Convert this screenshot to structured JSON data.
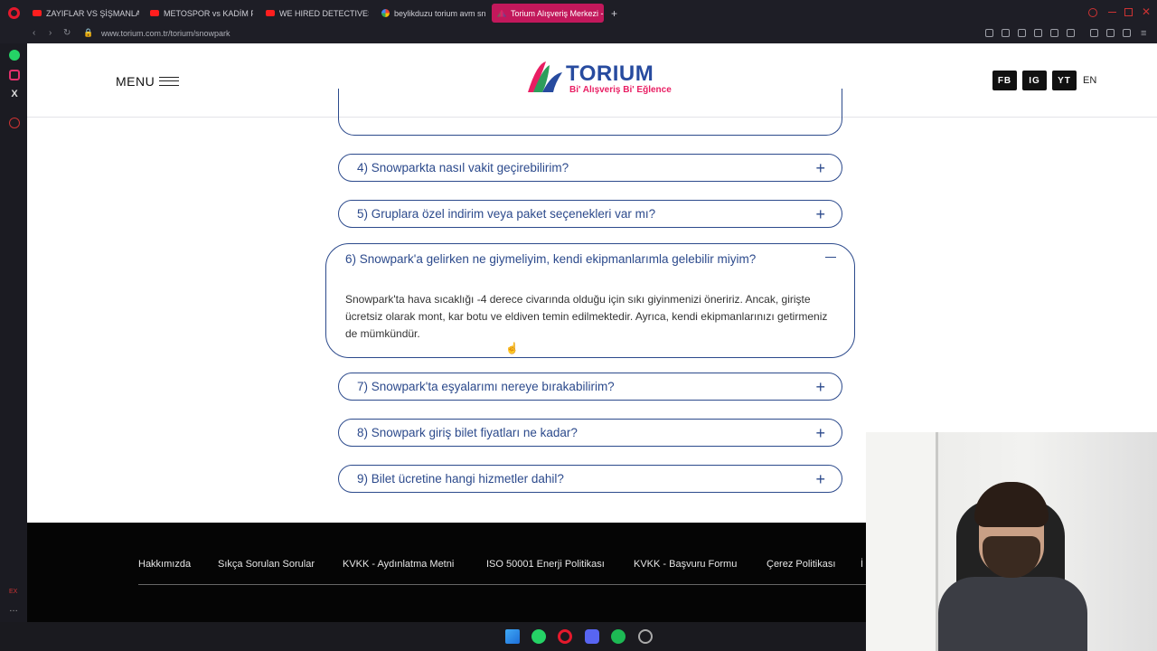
{
  "browser": {
    "tabs": [
      {
        "label": "ZAYIFLAR VS ŞİŞMANLAR",
        "icon": "youtube-icon"
      },
      {
        "label": "METOSPOR vs KADİM FU",
        "icon": "youtube-icon"
      },
      {
        "label": "WE HIRED DETECTIVES T",
        "icon": "youtube-icon"
      },
      {
        "label": "beylikduzu torium avm sn",
        "icon": "google-icon"
      },
      {
        "label": "Torium Alışveriş Merkezi -",
        "icon": "torium-icon"
      }
    ],
    "new_tab": "+",
    "url": "www.torium.com.tr/torium/snowpark"
  },
  "header": {
    "menu_label": "MENU",
    "logo_text": "TORIUM",
    "logo_tagline": "Bi' Alışveriş Bi' Eğlence",
    "social": [
      "FB",
      "IG",
      "YT"
    ],
    "language": "EN"
  },
  "faq": {
    "items": [
      {
        "q": "4) Snowparkta nasıl vakit geçirebilirim?"
      },
      {
        "q": "5) Gruplara özel indirim veya paket seçenekleri var mı?"
      },
      {
        "q": "7) Snowpark'ta eşyalarımı nereye bırakabilirim?"
      },
      {
        "q": "8) Snowpark giriş bilet fiyatları ne kadar?"
      },
      {
        "q": "9) Bilet ücretine hangi hizmetler dahil?"
      }
    ],
    "open": {
      "q": "6) Snowpark'a gelirken ne giymeliyim, kendi ekipmanlarımla gelebilir miyim?",
      "a": "Snowpark'ta hava sıcaklığı -4 derece civarında olduğu için sıkı giyinmenizi öneririz. Ancak, girişte ücretsiz olarak mont, kar botu ve eldiven temin edilmektedir. Ayrıca, kendi ekipmanlarınızı getirmeniz de mümkündür."
    },
    "plus": "+"
  },
  "footer": {
    "links": [
      "Hakkımızda",
      "Sıkça Sorulan Sorular",
      "KVKK - Aydınlatma Metni",
      "ISO 50001 Enerji Politikası",
      "KVKK - Başvuru Formu",
      "Çerez Politikası",
      "İ"
    ]
  }
}
